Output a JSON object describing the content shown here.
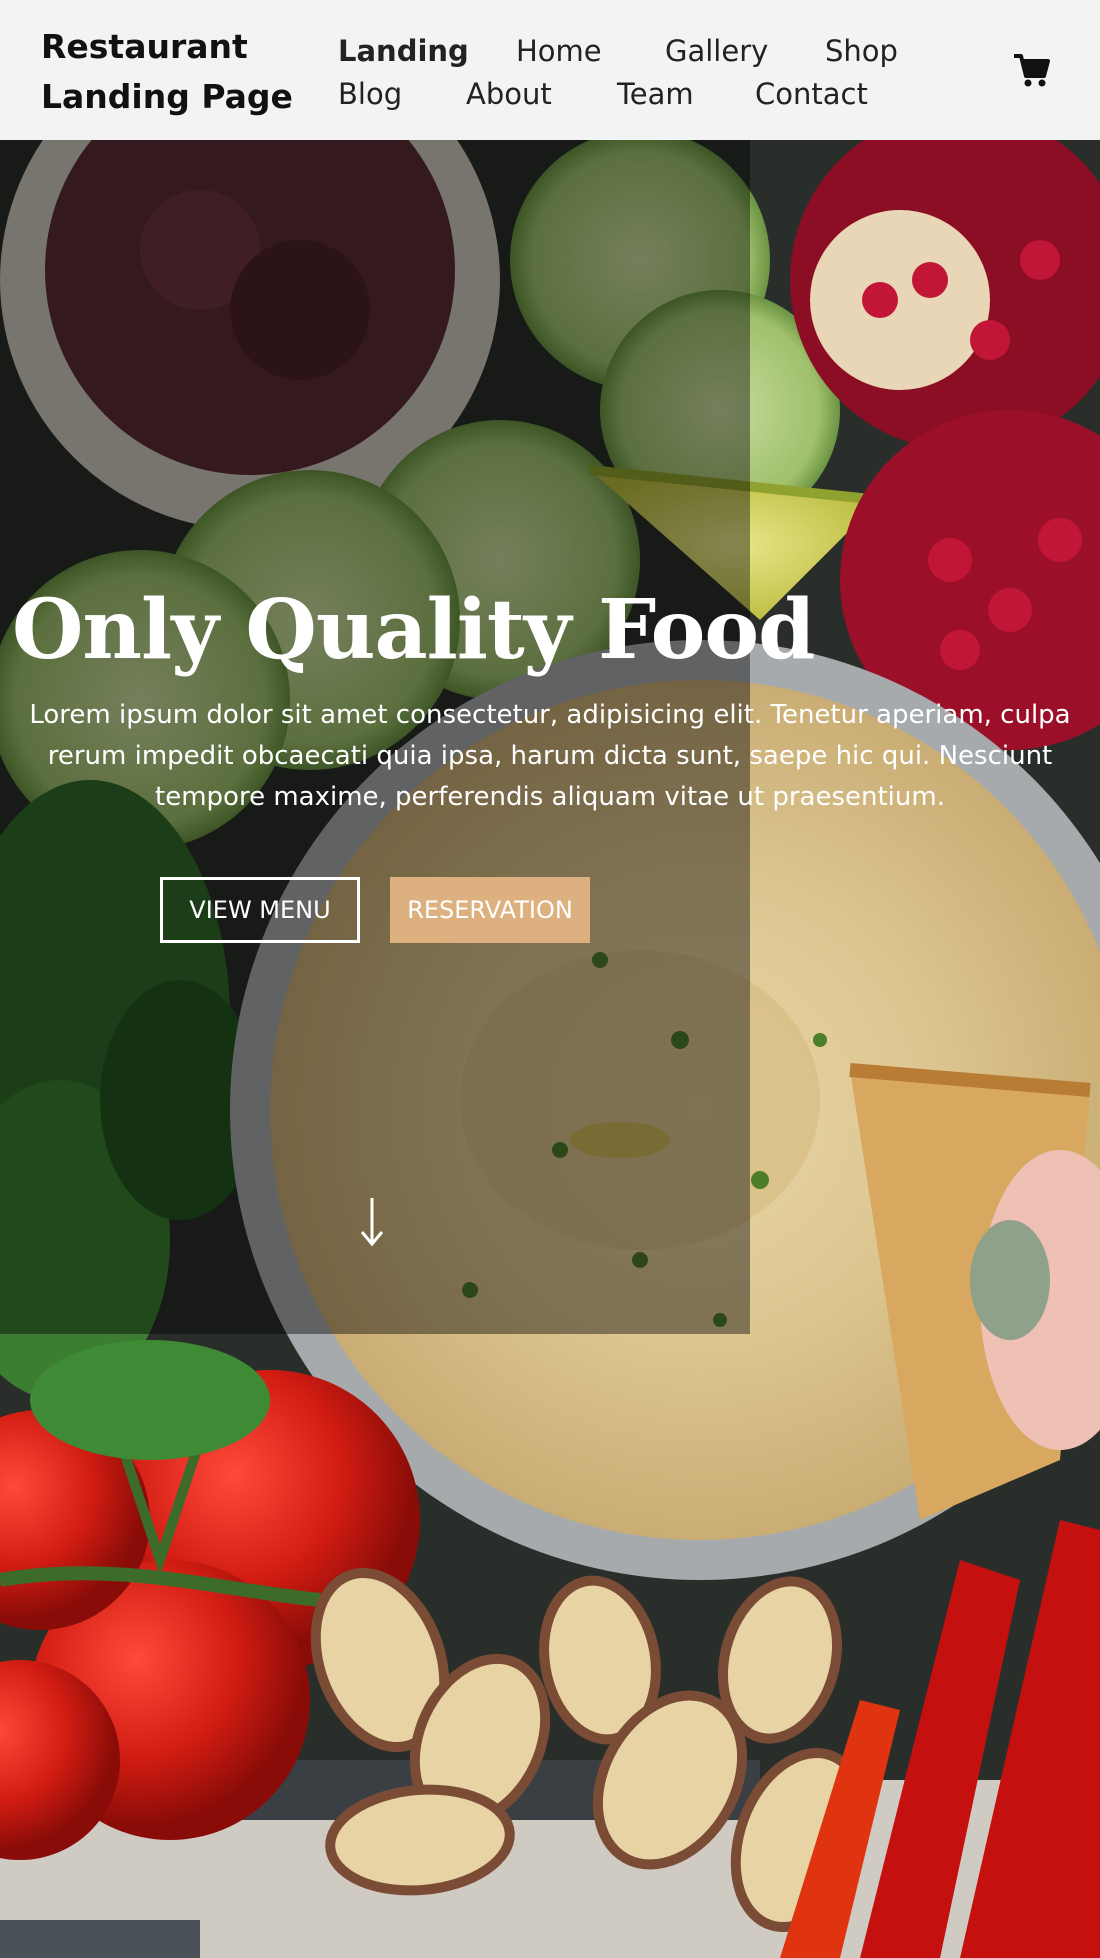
{
  "header": {
    "brand": "Restaurant Landing Page",
    "nav": [
      "Landing",
      "Home",
      "Gallery",
      "Shop",
      "Blog",
      "About",
      "Team",
      "Contact"
    ],
    "active": "Landing",
    "cart_icon": "cart-icon"
  },
  "hero": {
    "title": "Only Quality Food",
    "text": "Lorem ipsum dolor sit amet consectetur, adipisicing elit. Tenetur aperiam, culpa rerum impedit obcaecati quia ipsa, harum dicta sunt, saepe hic qui. Nesciunt tempore maxime, perferendis aliquam vitae ut praesentium.",
    "view_menu_label": "VIEW MENU",
    "reservation_label": "RESERVATION",
    "scroll_icon": "arrow-down-icon"
  },
  "colors": {
    "header_bg": "#f3f3f3",
    "accent": "#dcb17f",
    "text_light": "#ffffff"
  }
}
